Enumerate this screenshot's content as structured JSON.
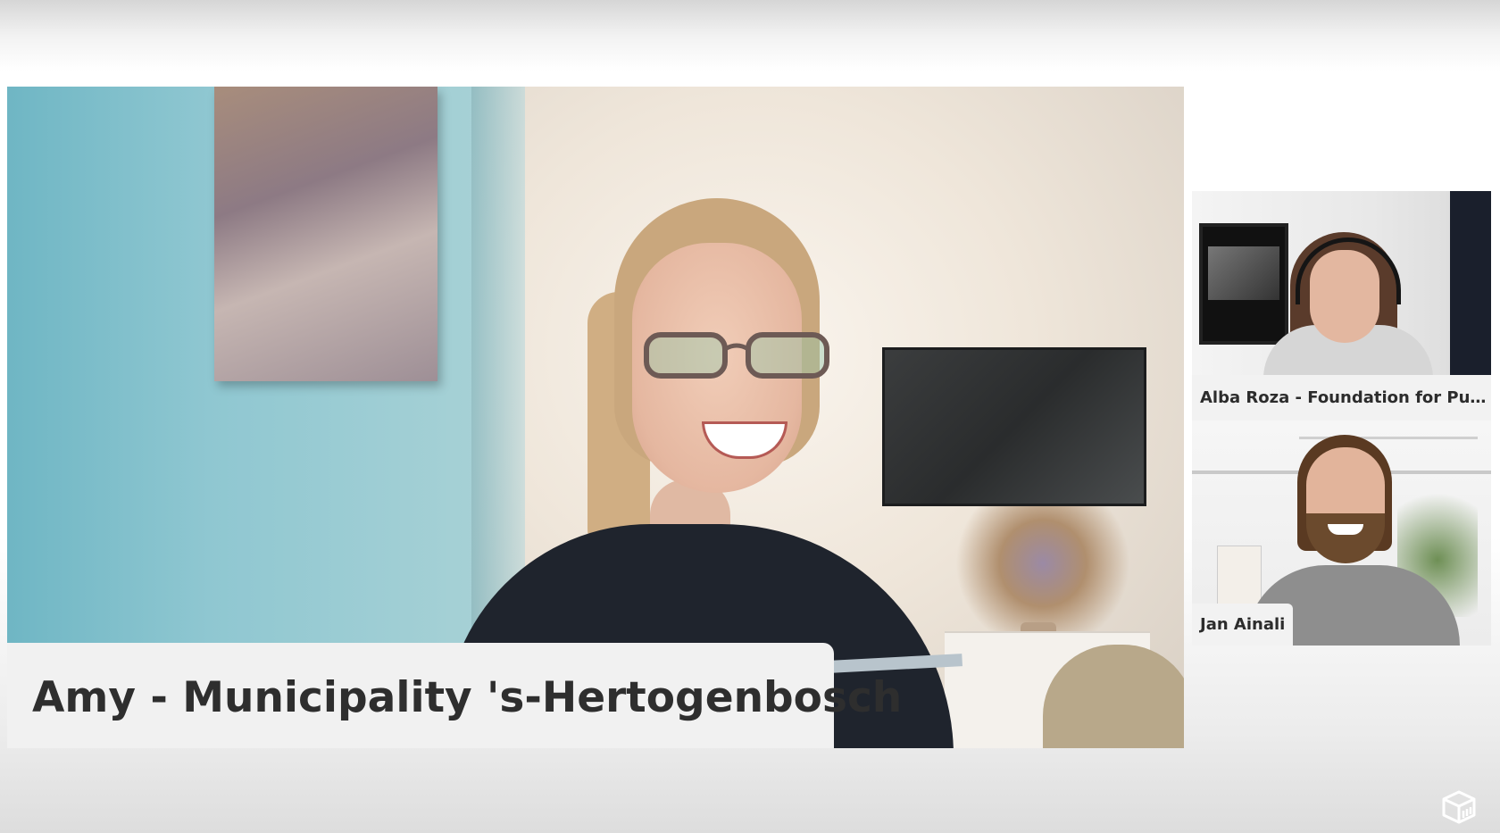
{
  "main_speaker": {
    "name": "Amy - Municipality 's-Hertogenbosch"
  },
  "participants": [
    {
      "name": "Alba Roza - Foundation for Publi…"
    },
    {
      "name": "Jan Ainali"
    }
  ],
  "icons": {
    "brand_logo": "cube-logo-icon"
  },
  "colors": {
    "label_background": "#f1f1f1",
    "label_text": "#2e2e2e"
  }
}
